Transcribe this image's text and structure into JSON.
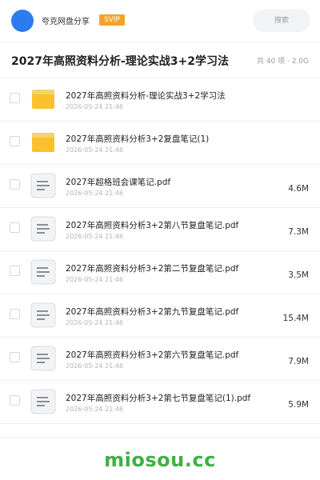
{
  "header": {
    "user_name": "夸克网盘分享",
    "badge": "SVIP",
    "search_placeholder": "搜索"
  },
  "folder": {
    "title": "2027年高照资料分析-理论实战3+2学习法",
    "count": "共 40 项 · 2.0G"
  },
  "files": [
    {
      "name": "2027年高照资料分析-理论实战3+2学习法",
      "date": "2026-05-24 21:46",
      "size": "",
      "type": "folder"
    },
    {
      "name": "2027年高照资料分析3+2复盘笔记(1)",
      "date": "2026-05-24 21:46",
      "size": "",
      "type": "folder"
    },
    {
      "name": "2027年超格班会课笔记.pdf",
      "date": "2026-05-24 21:46",
      "size": "4.6M",
      "type": "doc"
    },
    {
      "name": "2027年高照资料分析3+2第八节复盘笔记.pdf",
      "date": "2026-05-24 21:46",
      "size": "7.3M",
      "type": "doc"
    },
    {
      "name": "2027年高照资料分析3+2第二节复盘笔记.pdf",
      "date": "2026-05-24 21:46",
      "size": "3.5M",
      "type": "doc"
    },
    {
      "name": "2027年高照资料分析3+2第九节复盘笔记.pdf",
      "date": "2026-05-24 21:46",
      "size": "15.4M",
      "type": "doc"
    },
    {
      "name": "2027年高照资料分析3+2第六节复盘笔记.pdf",
      "date": "2026-05-24 21:46",
      "size": "7.9M",
      "type": "doc"
    },
    {
      "name": "2027年高照资料分析3+2第七节复盘笔记(1).pdf",
      "date": "2026-05-24 21:46",
      "size": "5.9M",
      "type": "doc"
    }
  ],
  "icons": {
    "folder": "folder-icon",
    "doc": "document-icon"
  },
  "colors": {
    "avatar": "#2b7bf1",
    "badge": "#f5a12a",
    "folder": "#fbc02d",
    "watermark": "#3fb045"
  },
  "watermark": "miosou.cc"
}
